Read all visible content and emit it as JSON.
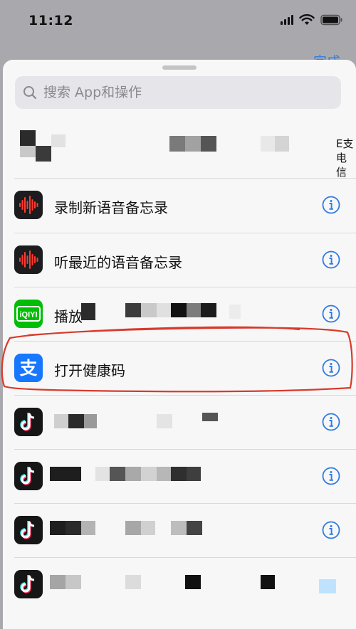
{
  "status_bar": {
    "time": "11:12"
  },
  "header": {
    "done_label": "完成"
  },
  "search": {
    "placeholder": "搜索 App和操作"
  },
  "strip": {
    "right_label_top": "E支",
    "right_label_bottom": "电信"
  },
  "actions": [
    {
      "label": "录制新语音备忘录",
      "icon": "voice-memos-icon"
    },
    {
      "label": "听最近的语音备忘录",
      "icon": "voice-memos-icon"
    },
    {
      "label": "播放",
      "icon": "iqiyi-icon"
    },
    {
      "label": "打开健康码",
      "icon": "alipay-icon",
      "highlighted": true
    },
    {
      "label": "",
      "icon": "tiktok-icon"
    },
    {
      "label": "",
      "icon": "tiktok-icon"
    },
    {
      "label": "",
      "icon": "tiktok-icon"
    },
    {
      "label": "",
      "icon": "tiktok-icon"
    }
  ],
  "colors": {
    "accent": "#2f7be0",
    "alipay": "#1677ff",
    "iqiyi": "#00be06",
    "annotation": "#d93a2b"
  }
}
